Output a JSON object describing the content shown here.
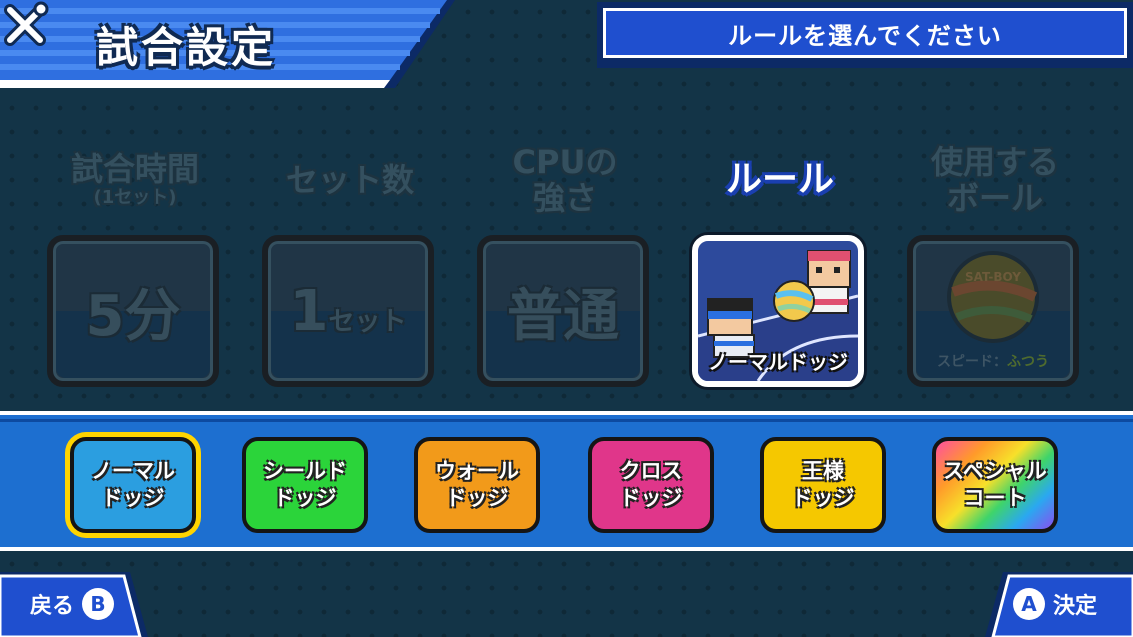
{
  "header": {
    "title": "試合設定",
    "instruction": "ルールを選んでください"
  },
  "settings": [
    {
      "label": "試合時間",
      "sublabel": "(1セット)",
      "value_main": "5",
      "value_small": "分"
    },
    {
      "label": "セット数",
      "value_main": "1",
      "value_small": "セット"
    },
    {
      "label_line1": "CPUの",
      "label_line2": "強さ",
      "value_main": "普通"
    },
    {
      "label": "ルール",
      "caption": "ノーマルドッジ"
    },
    {
      "label_line1": "使用する",
      "label_line2": "ボール",
      "speed_label": "スピード：",
      "speed_value": "ふつう",
      "ball_text": "SAT-BOY"
    }
  ],
  "rules": [
    {
      "line1": "ノーマル",
      "line2": "ドッジ",
      "color": "#2b9ee0",
      "selected": true
    },
    {
      "line1": "シールド",
      "line2": "ドッジ",
      "color": "#2bd43a"
    },
    {
      "line1": "ウォール",
      "line2": "ドッジ",
      "color": "#f29a1a"
    },
    {
      "line1": "クロス",
      "line2": "ドッジ",
      "color": "#e0368a"
    },
    {
      "line1": "王様",
      "line2": "ドッジ",
      "color": "#f5c800"
    },
    {
      "line1": "スペシャル",
      "line2": "コート",
      "color": "rainbow"
    }
  ],
  "footer": {
    "back_label": "戻る",
    "back_key": "B",
    "confirm_label": "決定",
    "confirm_key": "A"
  },
  "colors": {
    "accent_blue": "#1f4fcf",
    "strip_blue": "#1d6fd0",
    "selection": "#ffd400",
    "background": "#133447"
  }
}
